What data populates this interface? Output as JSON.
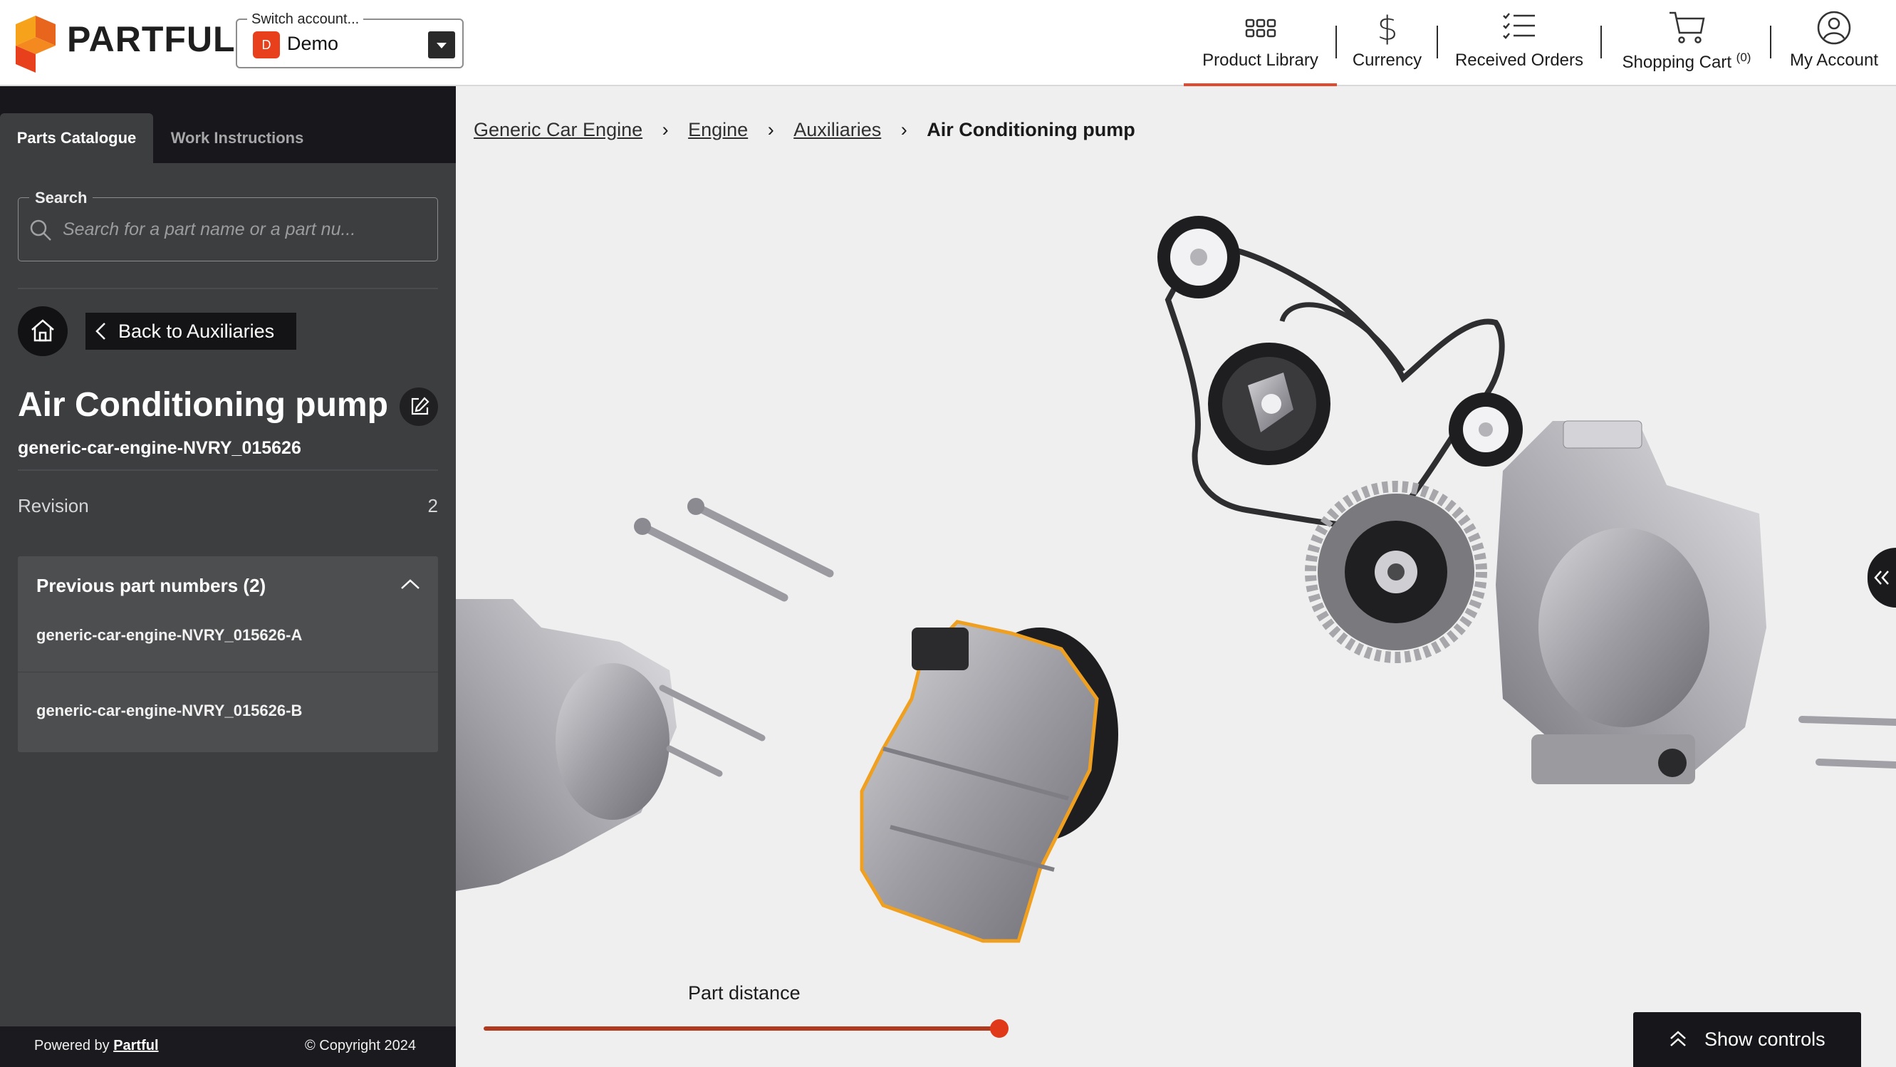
{
  "brand": {
    "name": "PARTFUL"
  },
  "account": {
    "legend": "Switch account...",
    "badge": "D",
    "name": "Demo"
  },
  "nav": {
    "product_library": "Product Library",
    "currency": "Currency",
    "received_orders": "Received Orders",
    "shopping_cart": "Shopping Cart",
    "cart_count": "(0)",
    "my_account": "My Account"
  },
  "sidebar": {
    "tabs": [
      "Parts Catalogue",
      "Work Instructions"
    ],
    "active_tab": "Parts Catalogue",
    "search": {
      "legend": "Search",
      "placeholder": "Search for a part name or a part nu..."
    },
    "back_label": "Back to Auxiliaries",
    "part": {
      "title": "Air Conditioning pump",
      "number": "generic-car-engine-NVRY_015626"
    },
    "revision": {
      "label": "Revision",
      "value": "2"
    },
    "previous": {
      "title": "Previous part numbers (2)",
      "items": [
        "generic-car-engine-NVRY_015626-A",
        "generic-car-engine-NVRY_015626-B"
      ]
    }
  },
  "footer": {
    "powered_prefix": "Powered by",
    "powered_link": "Partful",
    "copyright": "© Copyright 2024"
  },
  "breadcrumb": {
    "items": [
      "Generic Car Engine",
      "Engine",
      "Auxiliaries"
    ],
    "current": "Air Conditioning pump"
  },
  "viewer": {
    "distance_label": "Part distance",
    "distance_value": 1.0,
    "show_controls": "Show controls"
  },
  "colors": {
    "accent": "#e04a2f",
    "sidebar_bg": "#3d3e40",
    "dark": "#18171b",
    "highlight": "#f0a020"
  }
}
